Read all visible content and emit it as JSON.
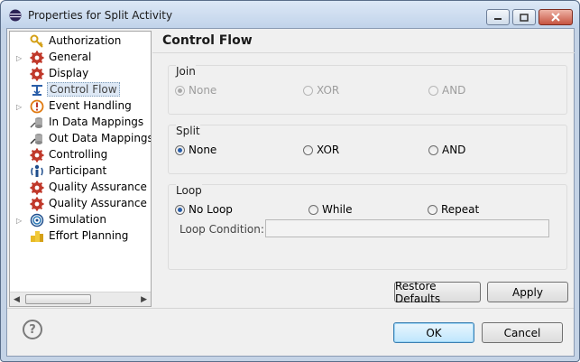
{
  "window": {
    "title": "Properties for Split Activity",
    "controls": [
      "minimize",
      "maximize",
      "close"
    ]
  },
  "tree": {
    "items": [
      {
        "label": "Authorization",
        "icon": "key-icon",
        "expander": false
      },
      {
        "label": "General",
        "icon": "gear-red-icon",
        "expander": true
      },
      {
        "label": "Display",
        "icon": "gear-red-icon",
        "expander": false
      },
      {
        "label": "Control Flow",
        "icon": "control-flow-icon",
        "expander": false,
        "selected": true
      },
      {
        "label": "Event Handling",
        "icon": "event-icon",
        "expander": true
      },
      {
        "label": "In Data Mappings",
        "icon": "data-in-icon",
        "expander": false
      },
      {
        "label": "Out Data Mappings",
        "icon": "data-out-icon",
        "expander": false
      },
      {
        "label": "Controlling",
        "icon": "gear-red-icon",
        "expander": false
      },
      {
        "label": "Participant",
        "icon": "participant-icon",
        "expander": false
      },
      {
        "label": "Quality Assurance",
        "icon": "gear-red-icon",
        "expander": false
      },
      {
        "label": "Quality Assurance Cc",
        "icon": "gear-red-icon",
        "expander": false
      },
      {
        "label": "Simulation",
        "icon": "simulation-icon",
        "expander": true
      },
      {
        "label": "Effort Planning",
        "icon": "effort-icon",
        "expander": false
      }
    ]
  },
  "panel": {
    "title": "Control Flow",
    "join": {
      "label": "Join",
      "options": [
        "None",
        "XOR",
        "AND"
      ],
      "selected": "None",
      "enabled": false
    },
    "split": {
      "label": "Split",
      "options": [
        "None",
        "XOR",
        "AND"
      ],
      "selected": "None",
      "enabled": true
    },
    "loop": {
      "label": "Loop",
      "options": [
        "No Loop",
        "While",
        "Repeat"
      ],
      "selected": "No Loop",
      "condition_label": "Loop Condition:",
      "condition_value": ""
    },
    "restore_defaults_label": "Restore Defaults",
    "apply_label": "Apply"
  },
  "footer": {
    "help_label": "?",
    "ok_label": "OK",
    "cancel_label": "Cancel"
  },
  "colors": {
    "titlebar": "#c1d3ea",
    "dialog_bg": "#f0f0f0",
    "accent_red": "#c0392b",
    "radio_dot": "#2a5ea8"
  }
}
